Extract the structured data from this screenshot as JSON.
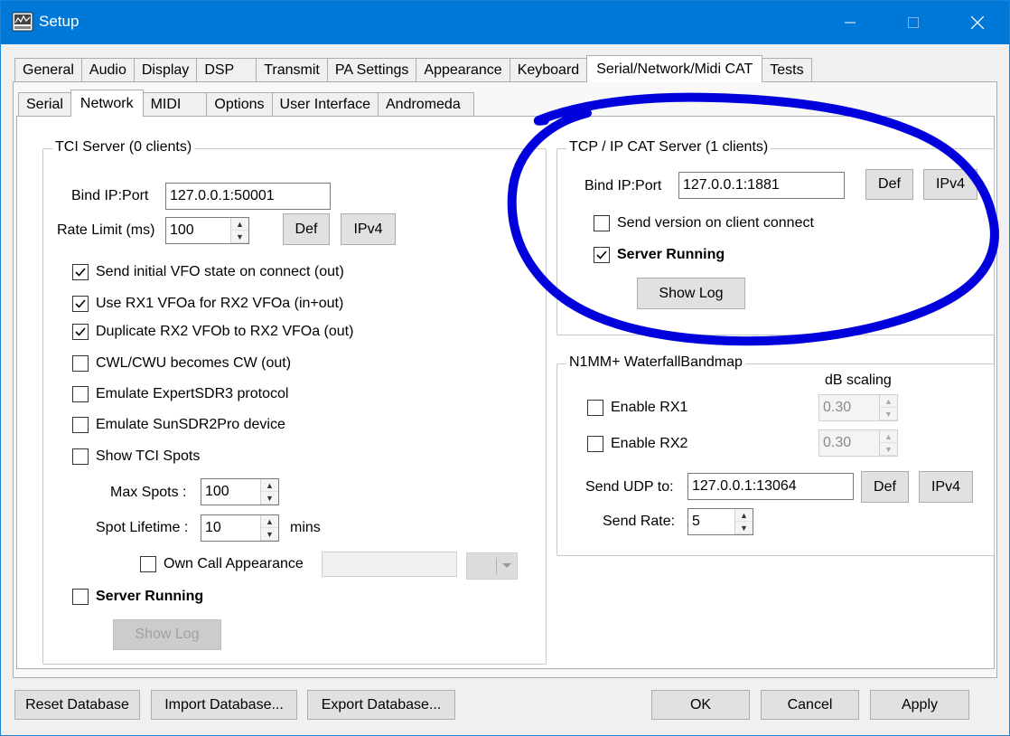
{
  "window": {
    "title": "Setup"
  },
  "main_tabs": [
    "General",
    "Audio",
    "Display",
    "DSP",
    "Transmit",
    "PA Settings",
    "Appearance",
    "Keyboard",
    "Serial/Network/Midi CAT",
    "Tests"
  ],
  "sub_tabs": [
    "Serial",
    "Network",
    "MIDI",
    "Options",
    "User Interface",
    "Andromeda"
  ],
  "tci": {
    "legend": "TCI Server (0 clients)",
    "bind_label": "Bind IP:Port",
    "bind_value": "127.0.0.1:50001",
    "rate_label": "Rate Limit (ms)",
    "rate_value": "100",
    "def_label": "Def",
    "ipv4_label": "IPv4",
    "checks": [
      {
        "label": "Send initial VFO state on connect (out)",
        "checked": true
      },
      {
        "label": "Use RX1 VFOa for RX2 VFOa (in+out)",
        "checked": true
      },
      {
        "label": "Duplicate RX2 VFOb to RX2 VFOa (out)",
        "checked": true
      },
      {
        "label": "CWL/CWU becomes CW (out)",
        "checked": false
      },
      {
        "label": "Emulate ExpertSDR3 protocol",
        "checked": false
      },
      {
        "label": "Emulate SunSDR2Pro device",
        "checked": false
      },
      {
        "label": "Show TCI Spots",
        "checked": false
      }
    ],
    "max_spots_label": "Max Spots :",
    "max_spots_value": "100",
    "spot_lifetime_label": "Spot Lifetime :",
    "spot_lifetime_value": "10",
    "mins_label": "mins",
    "own_call_label": "Own Call Appearance",
    "server_running_label": "Server Running",
    "show_log_label": "Show Log"
  },
  "tcpip": {
    "legend": "TCP / IP CAT Server (1 clients)",
    "bind_label": "Bind IP:Port",
    "bind_value": "127.0.0.1:1881",
    "def_label": "Def",
    "ipv4_label": "IPv4",
    "send_version_label": "Send version on client connect",
    "server_running_label": "Server Running",
    "show_log_label": "Show Log"
  },
  "n1mm": {
    "legend": "N1MM+ WaterfallBandmap",
    "db_scaling_label": "dB scaling",
    "enable_rx1_label": "Enable RX1",
    "rx1_value": "0.30",
    "enable_rx2_label": "Enable RX2",
    "rx2_value": "0.30",
    "send_udp_label": "Send UDP to:",
    "send_udp_value": "127.0.0.1:13064",
    "def_label": "Def",
    "ipv4_label": "IPv4",
    "send_rate_label": "Send Rate:",
    "send_rate_value": "5"
  },
  "bottom": {
    "reset": "Reset Database",
    "import": "Import Database...",
    "export": "Export Database...",
    "ok": "OK",
    "cancel": "Cancel",
    "apply": "Apply"
  },
  "colors": {
    "titlebar": "#0078d7",
    "annotation": "#0000dd"
  }
}
